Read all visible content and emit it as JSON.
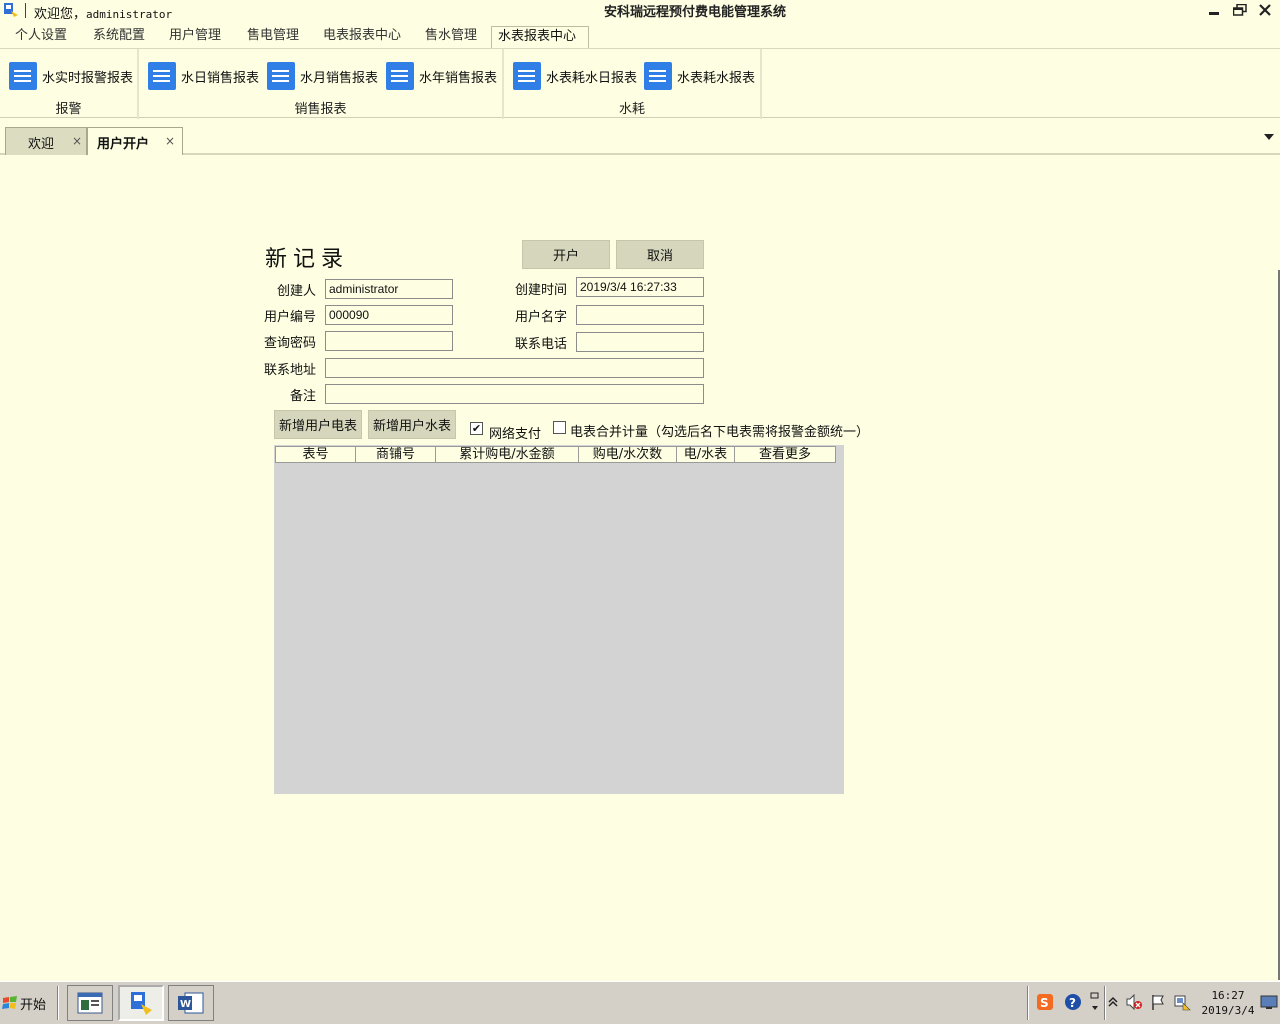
{
  "titlebar": {
    "welcome": "欢迎您，",
    "username": "administrator",
    "app_title": "安科瑞远程预付费电能管理系统"
  },
  "ribbon": {
    "tabs": [
      "个人设置",
      "系统配置",
      "用户管理",
      "售电管理",
      "电表报表中心",
      "售水管理",
      "水表报表中心"
    ],
    "active_tab": "水表报表中心",
    "groups": [
      {
        "label": "报警",
        "buttons": [
          "水实时报警报表"
        ]
      },
      {
        "label": "销售报表",
        "buttons": [
          "水日销售报表",
          "水月销售报表",
          "水年销售报表"
        ]
      },
      {
        "label": "水耗",
        "buttons": [
          "水表耗水日报表",
          "水表耗水报表"
        ]
      }
    ]
  },
  "doc_tabs": [
    {
      "label": "欢迎",
      "close": "×"
    },
    {
      "label": "用户开户",
      "close": "×"
    }
  ],
  "form": {
    "title": "新记录",
    "open_button": "开户",
    "cancel_button": "取消",
    "labels": {
      "creator": "创建人",
      "user_code": "用户编号",
      "query_password": "查询密码",
      "address": "联系地址",
      "remark": "备注",
      "created_time": "创建时间",
      "user_name": "用户名字",
      "phone": "联系电话"
    },
    "values": {
      "creator": "administrator",
      "user_code": "000090",
      "query_password": "",
      "address": "",
      "remark": "",
      "created_time": "2019/3/4 16:27:33",
      "user_name": "",
      "phone": ""
    },
    "add_electric_meter": "新增用户电表",
    "add_water_meter": "新增用户水表",
    "network_pay_label": "网络支付",
    "network_pay_checked": true,
    "merge_label": "电表合并计量（勾选后名下电表需将报警金额统一）",
    "merge_checked": false
  },
  "grid": {
    "columns": [
      "表号",
      "商铺号",
      "累计购电/水金额",
      "购电/水次数",
      "电/水表",
      "查看更多"
    ]
  },
  "taskbar": {
    "start": "开始",
    "clock_time": "16:27",
    "clock_date": "2019/3/4"
  },
  "colors": {
    "background": "#fefee2",
    "ribbon_icon": "#2f7fe6",
    "button": "#d6d6bd",
    "grid_body": "#d3d3d3",
    "taskbar": "#d4d0c8"
  }
}
